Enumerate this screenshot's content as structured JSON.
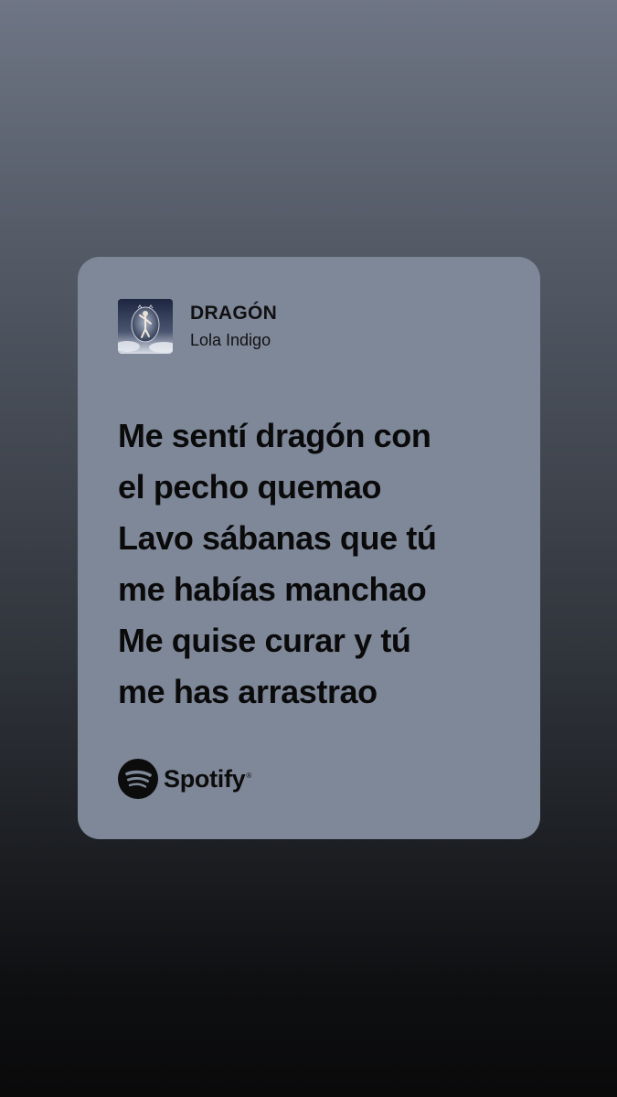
{
  "share_card": {
    "track": {
      "title": "DRAGÓN",
      "artist": "Lola Indigo",
      "cover_icon": "album-cover-image"
    },
    "lyrics": [
      "Me sentí dragón con",
      "el pecho quemao",
      "Lavo sábanas que tú",
      "me habías manchao",
      "Me quise curar y tú",
      "me has arrastrao"
    ],
    "brand": {
      "name": "Spotify",
      "icon": "spotify-logo-icon",
      "reg_mark": "®"
    },
    "colors": {
      "card_background": "#7f8899",
      "text": "#0a0a0a"
    }
  }
}
